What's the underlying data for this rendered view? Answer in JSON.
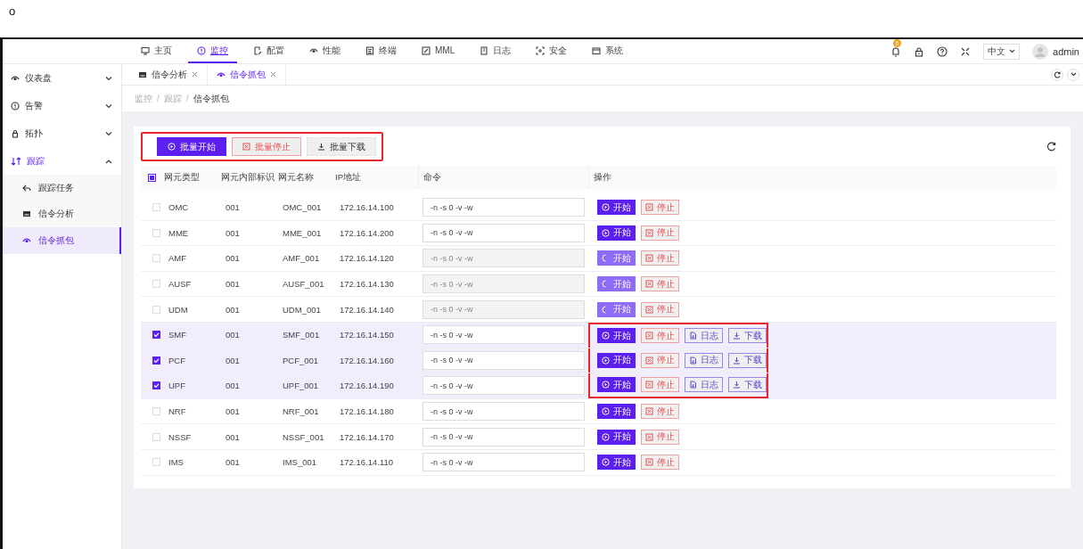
{
  "stray_mark": "o",
  "top_nav": {
    "items": [
      {
        "label": "主页",
        "selected": false
      },
      {
        "label": "监控",
        "selected": true
      },
      {
        "label": "配置",
        "selected": false
      },
      {
        "label": "性能",
        "selected": false
      },
      {
        "label": "终端",
        "selected": false
      },
      {
        "label": "MML",
        "selected": false
      },
      {
        "label": "日志",
        "selected": false
      },
      {
        "label": "安全",
        "selected": false
      },
      {
        "label": "系统",
        "selected": false
      }
    ],
    "notification_badge": "6",
    "language": "中文",
    "user": "admin"
  },
  "sidebar": {
    "items": [
      {
        "label": "仪表盘",
        "expanded": false
      },
      {
        "label": "告警",
        "expanded": false
      },
      {
        "label": "拓扑",
        "expanded": false
      },
      {
        "label": "跟踪",
        "expanded": true,
        "children": [
          {
            "label": "跟踪任务",
            "selected": false
          },
          {
            "label": "信令分析",
            "selected": false
          },
          {
            "label": "信令抓包",
            "selected": true
          }
        ]
      }
    ]
  },
  "tabs": [
    {
      "label": "信令分析",
      "selected": false
    },
    {
      "label": "信令抓包",
      "selected": true
    }
  ],
  "breadcrumb": {
    "separator": "/",
    "items": [
      "监控",
      "跟踪",
      "信令抓包"
    ]
  },
  "toolbar": {
    "highlighted": true,
    "buttons": [
      {
        "kind": "primary",
        "label": "批量开始"
      },
      {
        "kind": "danger",
        "label": "批量停止"
      },
      {
        "kind": "plain",
        "label": "批量下载"
      }
    ]
  },
  "table": {
    "select_all_indeterminate": true,
    "columns": [
      "网元类型",
      "网元内部标识",
      "网元名称",
      "IP地址",
      "命令",
      "操作"
    ],
    "rows": [
      {
        "type": "OMC",
        "internal_id": "001",
        "name": "OMC_001",
        "ip": "172.16.14.100",
        "command": "-n -s 0 -v -w",
        "selected": false,
        "disabled": false,
        "highlighted": false,
        "actions": [
          {
            "kind": "start",
            "label": "开始"
          },
          {
            "kind": "stop",
            "label": "停止"
          }
        ]
      },
      {
        "type": "MME",
        "internal_id": "001",
        "name": "MME_001",
        "ip": "172.16.14.200",
        "command": "-n -s 0 -v -w",
        "selected": false,
        "disabled": false,
        "highlighted": false,
        "actions": [
          {
            "kind": "start",
            "label": "开始"
          },
          {
            "kind": "stop",
            "label": "停止"
          }
        ]
      },
      {
        "type": "AMF",
        "internal_id": "001",
        "name": "AMF_001",
        "ip": "172.16.14.120",
        "command": "-n -s 0 -v -w",
        "selected": false,
        "disabled": true,
        "highlighted": false,
        "actions": [
          {
            "kind": "start",
            "label": "开始"
          },
          {
            "kind": "stop",
            "label": "停止"
          }
        ]
      },
      {
        "type": "AUSF",
        "internal_id": "001",
        "name": "AUSF_001",
        "ip": "172.16.14.130",
        "command": "-n -s 0 -v -w",
        "selected": false,
        "disabled": true,
        "highlighted": false,
        "actions": [
          {
            "kind": "start",
            "label": "开始"
          },
          {
            "kind": "stop",
            "label": "停止"
          }
        ]
      },
      {
        "type": "UDM",
        "internal_id": "001",
        "name": "UDM_001",
        "ip": "172.16.14.140",
        "command": "-n -s 0 -v -w",
        "selected": false,
        "disabled": true,
        "highlighted": false,
        "actions": [
          {
            "kind": "start",
            "label": "开始"
          },
          {
            "kind": "stop",
            "label": "停止"
          }
        ]
      },
      {
        "type": "SMF",
        "internal_id": "001",
        "name": "SMF_001",
        "ip": "172.16.14.150",
        "command": "-n -s 0 -v -w",
        "selected": true,
        "disabled": false,
        "highlighted": true,
        "actions": [
          {
            "kind": "start",
            "label": "开始"
          },
          {
            "kind": "stop",
            "label": "停止"
          },
          {
            "kind": "log",
            "label": "日志"
          },
          {
            "kind": "download",
            "label": "下载"
          }
        ]
      },
      {
        "type": "PCF",
        "internal_id": "001",
        "name": "PCF_001",
        "ip": "172.16.14.160",
        "command": "-n -s 0 -v -w",
        "selected": true,
        "disabled": false,
        "highlighted": true,
        "actions": [
          {
            "kind": "start",
            "label": "开始"
          },
          {
            "kind": "stop",
            "label": "停止"
          },
          {
            "kind": "log",
            "label": "日志"
          },
          {
            "kind": "download",
            "label": "下载"
          }
        ]
      },
      {
        "type": "UPF",
        "internal_id": "001",
        "name": "UPF_001",
        "ip": "172.16.14.190",
        "command": "-n -s 0 -v -w",
        "selected": true,
        "disabled": false,
        "highlighted": true,
        "actions": [
          {
            "kind": "start",
            "label": "开始"
          },
          {
            "kind": "stop",
            "label": "停止"
          },
          {
            "kind": "log",
            "label": "日志"
          },
          {
            "kind": "download",
            "label": "下载"
          }
        ]
      },
      {
        "type": "NRF",
        "internal_id": "001",
        "name": "NRF_001",
        "ip": "172.16.14.180",
        "command": "-n -s 0 -v -w",
        "selected": false,
        "disabled": false,
        "highlighted": false,
        "actions": [
          {
            "kind": "start",
            "label": "开始"
          },
          {
            "kind": "stop",
            "label": "停止"
          }
        ]
      },
      {
        "type": "NSSF",
        "internal_id": "001",
        "name": "NSSF_001",
        "ip": "172.16.14.170",
        "command": "-n -s 0 -v -w",
        "selected": false,
        "disabled": false,
        "highlighted": false,
        "actions": [
          {
            "kind": "start",
            "label": "开始"
          },
          {
            "kind": "stop",
            "label": "停止"
          }
        ]
      },
      {
        "type": "IMS",
        "internal_id": "001",
        "name": "IMS_001",
        "ip": "172.16.14.110",
        "command": "-n -s 0 -v -w",
        "selected": false,
        "disabled": false,
        "highlighted": false,
        "actions": [
          {
            "kind": "start",
            "label": "开始"
          },
          {
            "kind": "stop",
            "label": "停止"
          }
        ]
      }
    ]
  }
}
